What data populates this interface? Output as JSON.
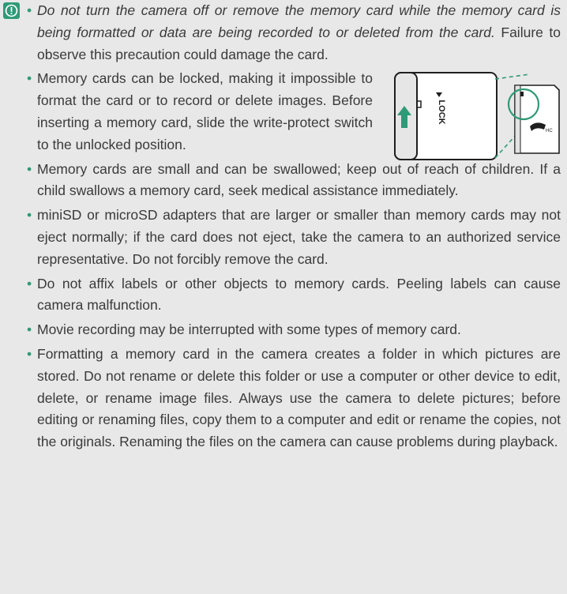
{
  "icons": {
    "caution": "caution-icon"
  },
  "notes": [
    {
      "em": "Do not turn the camera off or remove the memory card while the memory card is being formatted or data are being recorded to or deleted from the card.",
      "text": " Failure to observe this precaution could damage the card."
    },
    {
      "text": "Memory cards can be locked, making it impossible to format the card or to record or delete images. Before inserting a memory card, slide the write-protect switch to the unlocked position."
    },
    {
      "text": "Memory cards are small and can be swallowed; keep out of reach of children. If a child swallows a memory card, seek medical assistance immediately."
    },
    {
      "text": "miniSD or microSD adapters that are larger or smaller than memory cards may not eject normally; if the card does not eject, take the camera to an authorized service representative. Do not forcibly remove the card."
    },
    {
      "text": "Do not affix labels or other objects to memory cards. Peeling labels can cause camera malfunction."
    },
    {
      "text": "Movie recording may be interrupted with some types of memory card."
    },
    {
      "text": "Formatting a memory card in the camera creates a folder in which pictures are stored. Do not rename or delete this folder or use a computer or other device to edit, delete, or rename image files. Always use the camera to delete pictures; before editing or renaming files, copy them to a computer and edit or rename the copies, not the originals. Renaming the files on the camera can cause problems during playback."
    }
  ],
  "figure": {
    "lock_label": "LOCK",
    "arrow_color": "#2f9a77"
  }
}
